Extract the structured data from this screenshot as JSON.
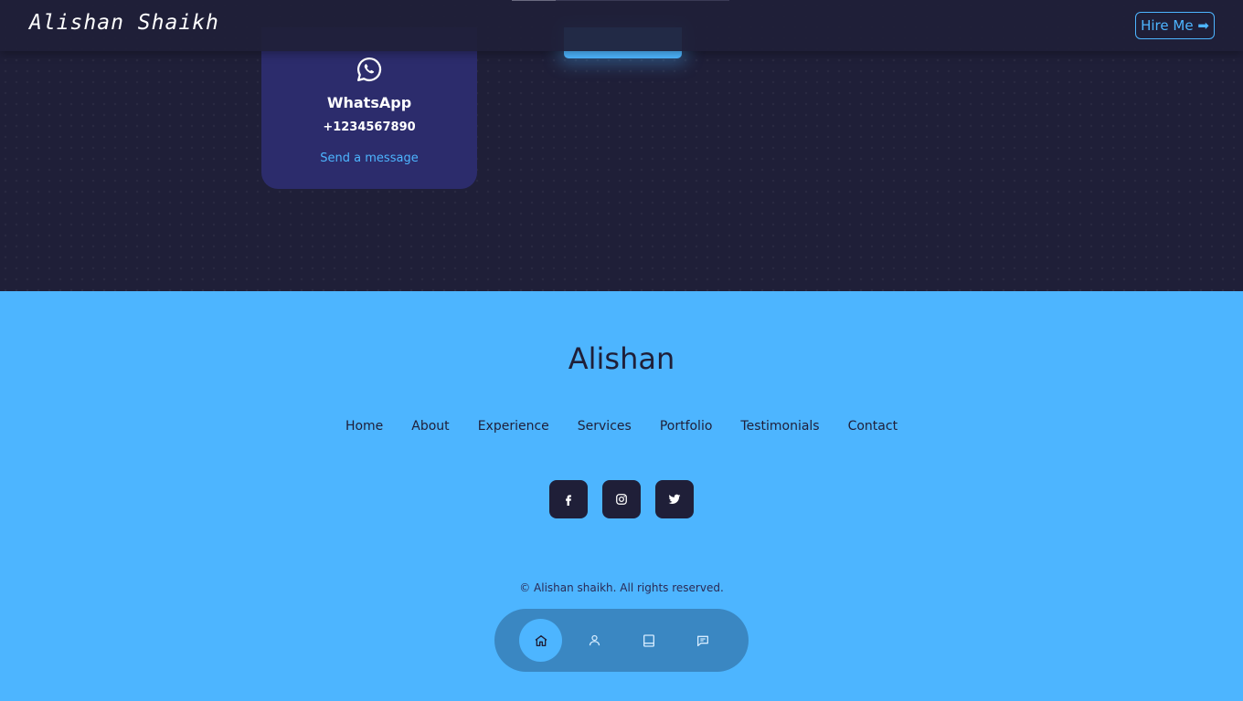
{
  "header": {
    "brand": "Alishan Shaikh",
    "hire_label": "Hire Me ➡"
  },
  "contact": {
    "card": {
      "icon": "whatsapp-icon",
      "title": "WhatsApp",
      "value": "+1234567890",
      "link_label": "Send a message"
    }
  },
  "footer": {
    "logo": "Alishan",
    "links": [
      "Home",
      "About",
      "Experience",
      "Services",
      "Portfolio",
      "Testimonials",
      "Contact"
    ],
    "socials": [
      "facebook-icon",
      "instagram-icon",
      "twitter-icon"
    ],
    "copyright": "© Alishan shaikh. All rights reserved."
  },
  "float_nav": {
    "items": [
      "home-icon",
      "user-icon",
      "book-icon",
      "message-icon"
    ],
    "active": "home-icon"
  },
  "colors": {
    "background": "#1f1f38",
    "card": "#2c2c6c",
    "accent": "#4db5ff",
    "float_nav": "#3a87c2"
  }
}
